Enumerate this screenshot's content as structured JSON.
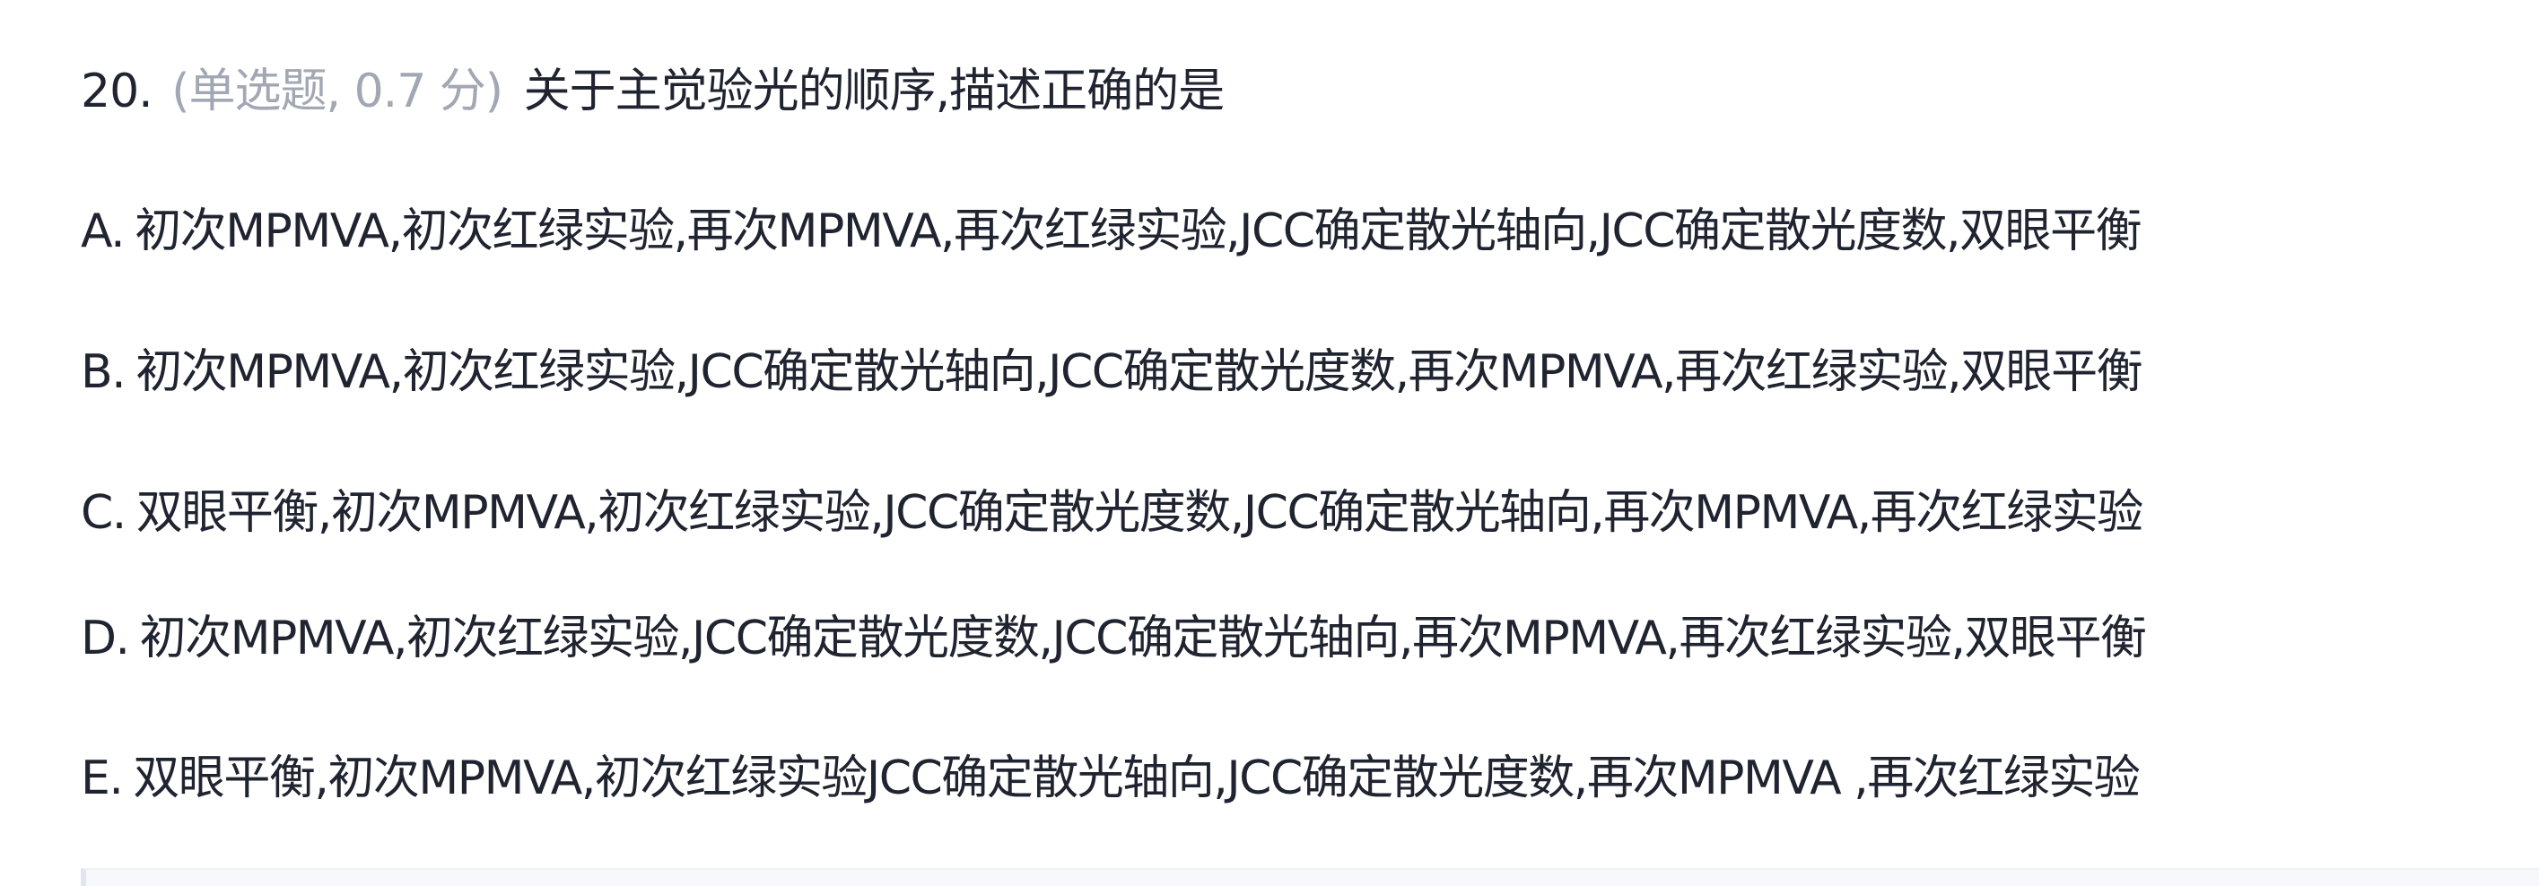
{
  "question": {
    "number": "20.",
    "meta": "(单选题, 0.7 分)",
    "stem": "关于主觉验光的顺序,描述正确的是"
  },
  "options": [
    {
      "letter": "A.",
      "text": "初次MPMVA,初次红绿实验,再次MPMVA,再次红绿实验,JCC确定散光轴向,JCC确定散光度数,双眼平衡"
    },
    {
      "letter": "B.",
      "text": "初次MPMVA,初次红绿实验,JCC确定散光轴向,JCC确定散光度数,再次MPMVA,再次红绿实验,双眼平衡"
    },
    {
      "letter": "C.",
      "text": "双眼平衡,初次MPMVA,初次红绿实验,JCC确定散光度数,JCC确定散光轴向,再次MPMVA,再次红绿实验"
    },
    {
      "letter": "D.",
      "text": "初次MPMVA,初次红绿实验,JCC确定散光度数,JCC确定散光轴向,再次MPMVA,再次红绿实验,双眼平衡"
    },
    {
      "letter": "E.",
      "text": "双眼平衡,初次MPMVA,初次红绿实验JCC确定散光轴向,JCC确定散光度数,再次MPMVA ,再次红绿实验"
    }
  ]
}
